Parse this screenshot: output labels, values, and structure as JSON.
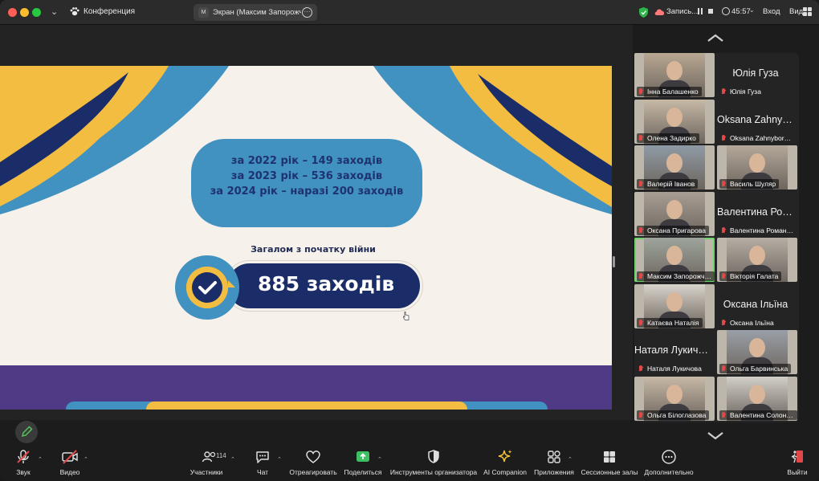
{
  "titlebar": {
    "meeting_title": "Конференция",
    "share_badge": "M",
    "share_label": "Экран (Максим Запорожченко)",
    "recording": "Запись...",
    "timer": "45:57",
    "login": "Вход",
    "view": "Вид"
  },
  "slide": {
    "years": [
      "за 2022 рік – 149 заходів",
      "за 2023 рік – 536 заходів",
      "за 2024 рік – наразі 200 заходів"
    ],
    "total_label": "Загалом з початку війни",
    "total_value": "885 заходів",
    "colors": {
      "yellow": "#f3bd41",
      "blue": "#4191c1",
      "navy": "#1a2d68",
      "purple": "#4f3a86",
      "cream": "#f6f1ea"
    }
  },
  "participants": [
    {
      "tag": "Інна Балашенко",
      "display": "",
      "video": true
    },
    {
      "tag": "Юлія Гуза",
      "display": "Юлія Гуза",
      "video": false
    },
    {
      "tag": "Олена Задирко",
      "display": "",
      "video": true
    },
    {
      "tag": "Oksana Zahnyboroda",
      "display": "Oksana Zahnyboroda",
      "video": false
    },
    {
      "tag": "Валерій Іванов",
      "display": "",
      "video": true
    },
    {
      "tag": "Василь Шуляр",
      "display": "",
      "video": true
    },
    {
      "tag": "Оксана Пригарова",
      "display": "",
      "video": true
    },
    {
      "tag": "Валентина Романець",
      "display": "Валентина Романець",
      "video": false
    },
    {
      "tag": "Максим Запорожченко",
      "display": "",
      "video": true,
      "active": true
    },
    {
      "tag": "Вікторія Галата",
      "display": "",
      "video": true
    },
    {
      "tag": "Катаєва Наталія",
      "display": "",
      "video": true
    },
    {
      "tag": "Оксана Ільїна",
      "display": "Оксана Ільїна",
      "video": false
    },
    {
      "tag": "Наталя Лукичова",
      "display": "Наталя Лукичова",
      "video": false
    },
    {
      "tag": "Ольга Барвинська",
      "display": "",
      "video": true
    },
    {
      "tag": "Ольга Білоглазова",
      "display": "",
      "video": true
    },
    {
      "tag": "Валентина Солончева",
      "display": "",
      "video": true
    }
  ],
  "toolbar": {
    "audio": "Звук",
    "video": "Видео",
    "participants": "Участники",
    "participants_count": "114",
    "chat": "Чат",
    "react": "Отреагировать",
    "share": "Поделиться",
    "host_tools": "Инструменты организатора",
    "ai_companion": "AI Companion",
    "apps": "Приложения",
    "breakout": "Сессионные залы",
    "more": "Дополнительно",
    "leave": "Выйти"
  }
}
